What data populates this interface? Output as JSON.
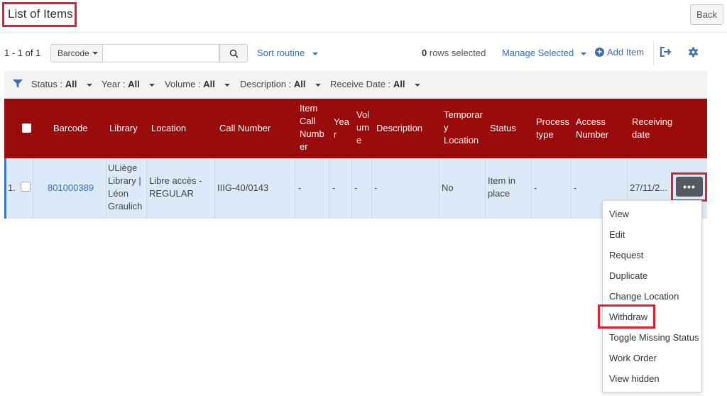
{
  "page": {
    "title": "List of Items",
    "back_label": "Back"
  },
  "toolbar": {
    "count": "1 - 1 of 1",
    "search_field": "Barcode",
    "search_value": "",
    "sort_label": "Sort routine",
    "rows_selected_count": "0",
    "rows_selected_text": "rows selected",
    "manage_selected": "Manage Selected",
    "add_item": "Add Item",
    "icons": [
      "search-icon",
      "export-icon",
      "gear-icon",
      "plus-circle-icon"
    ]
  },
  "filters": [
    {
      "label": "Status :",
      "value": "All"
    },
    {
      "label": "Year :",
      "value": "All"
    },
    {
      "label": "Volume :",
      "value": "All"
    },
    {
      "label": "Description :",
      "value": "All"
    },
    {
      "label": "Receive Date :",
      "value": "All"
    }
  ],
  "table": {
    "columns": {
      "barcode": "Barcode",
      "library": "Library",
      "location": "Location",
      "call_number": "Call Number",
      "item_call_1": "Item",
      "item_call_2": "Call",
      "item_call_3": "Numb",
      "item_call_4": "er",
      "year_1": "Yea",
      "year_2": "r",
      "volume_1": "Vol",
      "volume_2": "um",
      "volume_3": "e",
      "description": "Description",
      "temp_loc_1": "Temporar",
      "temp_loc_2": "y",
      "temp_loc_3": "Location",
      "status": "Status",
      "process_1": "Process",
      "process_2": "type",
      "access_1": "Access",
      "access_2": "Number",
      "receiving_1": "Receiving",
      "receiving_2": "date"
    },
    "rows": [
      {
        "index": "1.",
        "barcode": "801000389",
        "library_1": "ULiège",
        "library_2": "Library |",
        "library_3": "Léon",
        "library_4": "Graulich",
        "location_1": "Libre accès -",
        "location_2": "REGULAR",
        "call_number": "IIIG-40/0143",
        "item_call_number": "-",
        "year": "-",
        "volume": "-",
        "description": "-",
        "temporary_location": "No",
        "status_1": "Item in",
        "status_2": "place",
        "process_type": "-",
        "access_number": "-",
        "receiving_date": "27/11/2..."
      }
    ]
  },
  "row_actions": {
    "button_label": "•••",
    "menu": [
      "View",
      "Edit",
      "Request",
      "Duplicate",
      "Change Location",
      "Withdraw",
      "Toggle Missing Status",
      "Work Order",
      "View hidden"
    ]
  },
  "colors": {
    "header_bg": "#9a0b0b",
    "row_selected_bg": "#dbe9f8",
    "link": "#3a6fb0",
    "highlight": "#e0202e"
  }
}
